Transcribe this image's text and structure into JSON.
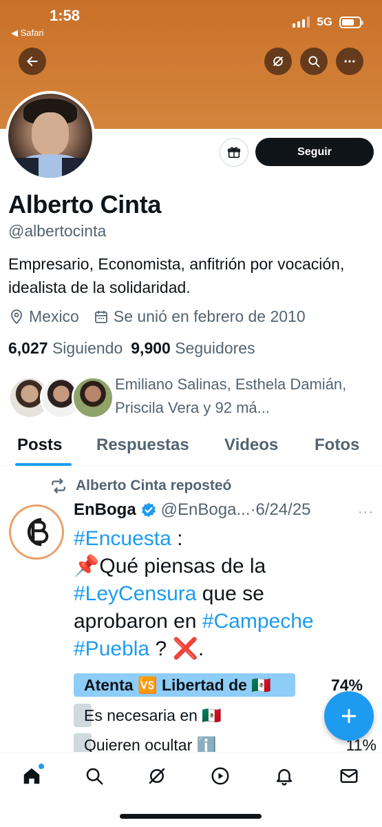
{
  "status_bar": {
    "time": "1:58",
    "back_app": "◀ Safari",
    "network": "5G"
  },
  "colors": {
    "banner": "#cf7a32",
    "accent": "#1d9bf0",
    "follow_bg": "#0f1419"
  },
  "header_icons": [
    "back-arrow-icon",
    "grok-icon",
    "search-icon",
    "more-icon"
  ],
  "profile": {
    "name": "Alberto Cinta",
    "handle": "@albertocinta",
    "bio": "Empresario, Economista, anfitrión por vocación, idealista de la solidaridad.",
    "location": "Mexico",
    "joined": "Se unió en febrero de 2010",
    "following_count": "6,027",
    "following_label": "Siguiendo",
    "followers_count": "9,900",
    "followers_label": "Seguidores",
    "followed_by": "Emiliano Salinas, Esthela Damián, Priscila Vera y 92 má..."
  },
  "actions": {
    "follow_label": "Seguir"
  },
  "tabs": [
    {
      "label": "Posts",
      "active": true
    },
    {
      "label": "Respuestas",
      "active": false
    },
    {
      "label": "Videos",
      "active": false
    },
    {
      "label": "Fotos",
      "active": false
    }
  ],
  "post": {
    "repost_text": "Alberto Cinta reposteó",
    "display_name": "EnBoga",
    "username_date": "@EnBoga...·6/24/25",
    "more": "···",
    "text": {
      "tag1": "#Encuesta",
      "after_tag1": " :",
      "line2": "📌Qué piensas de la",
      "tag2": "#LeyCensura",
      "after_tag2": " que se aprobaron en ",
      "tag3": "#Campeche",
      "tag4": "#Puebla",
      "tail": " ? ❌."
    },
    "poll": [
      {
        "label": "Atenta 🆚 Libertad de 🇲🇽",
        "percent": "74%",
        "fraction": 0.74,
        "leading": true
      },
      {
        "label": "Es necesaria en 🇲🇽",
        "percent": "",
        "fraction": 0.06,
        "leading": false
      },
      {
        "label": "Quieren ocultar ℹ️",
        "percent": "11%",
        "fraction": 0.11,
        "leading": false
      }
    ]
  },
  "bottom_nav": [
    "home-icon",
    "search-icon",
    "grok-icon",
    "video-icon",
    "bell-icon",
    "mail-icon"
  ]
}
